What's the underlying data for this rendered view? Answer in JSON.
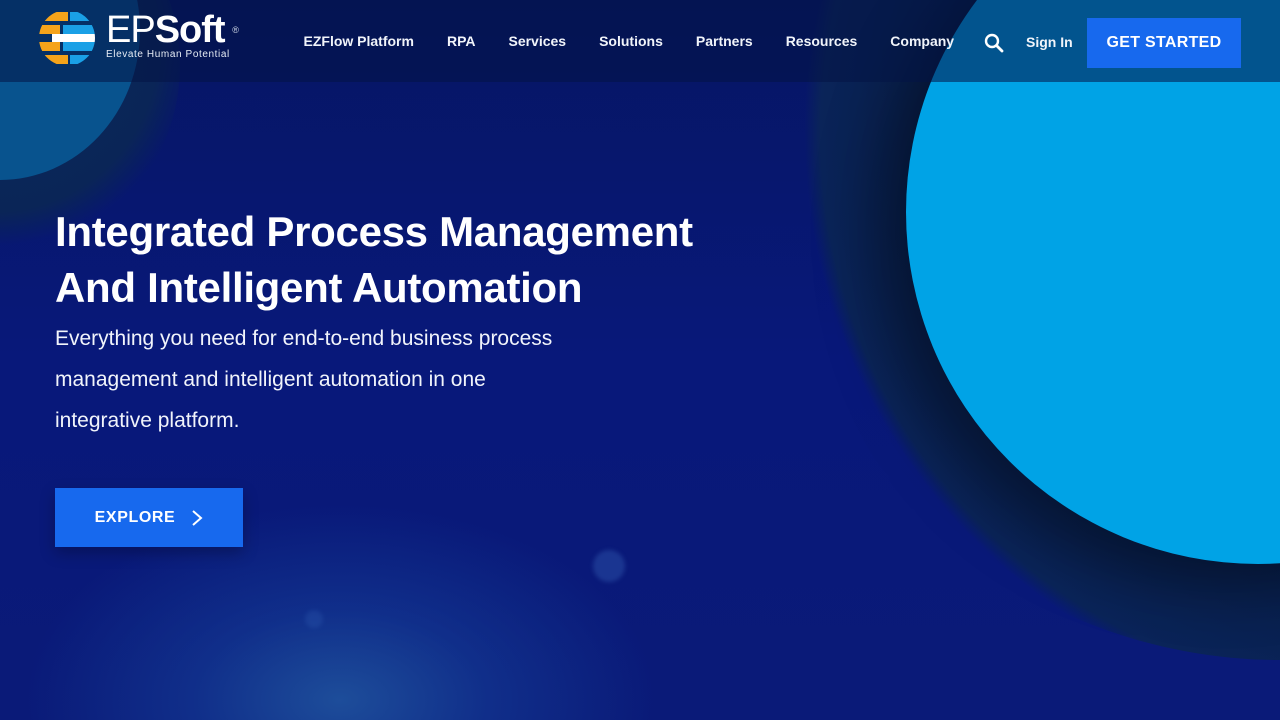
{
  "brand": {
    "name_prefix": "EP",
    "name_suffix": "Soft",
    "registered": "®",
    "tagline": "Elevate Human Potential",
    "logo_colors": [
      "#f5a31a",
      "#1aa0e6"
    ]
  },
  "nav": {
    "items": [
      {
        "label": "EZFlow Platform"
      },
      {
        "label": "RPA"
      },
      {
        "label": "Services"
      },
      {
        "label": "Solutions"
      },
      {
        "label": "Partners"
      },
      {
        "label": "Resources"
      },
      {
        "label": "Company"
      }
    ],
    "search_icon": "search-icon",
    "sign_in": "Sign In",
    "cta": "GET STARTED"
  },
  "hero": {
    "title_line1": "Integrated Process Management",
    "title_line2": "And Intelligent Automation",
    "description": "Everything you need for end-to-end business process management and intelligent automation in one integrative platform.",
    "button_label": "EXPLORE",
    "button_icon": "chevron-right-icon"
  },
  "colors": {
    "background": "#071a6b",
    "accent_button": "#1769ee",
    "circle_light": "#00a3e6",
    "circle_dark": "#061a3e"
  }
}
